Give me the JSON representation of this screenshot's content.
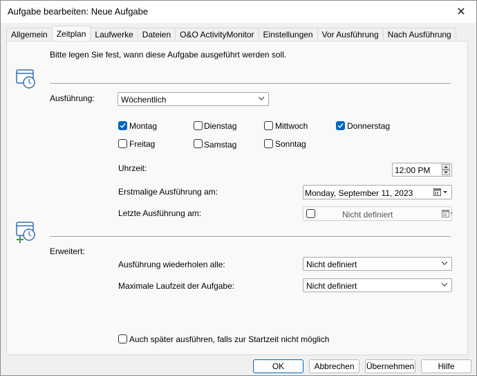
{
  "window": {
    "title": "Aufgabe bearbeiten: Neue Aufgabe",
    "close_glyph": "✕"
  },
  "tabs": [
    {
      "label": "Allgemein",
      "active": false
    },
    {
      "label": "Zeitplan",
      "active": true
    },
    {
      "label": "Laufwerke",
      "active": false
    },
    {
      "label": "Dateien",
      "active": false
    },
    {
      "label": "O&O ActivityMonitor",
      "active": false
    },
    {
      "label": "Einstellungen",
      "active": false
    },
    {
      "label": "Vor Ausführung",
      "active": false
    },
    {
      "label": "Nach Ausführung",
      "active": false
    }
  ],
  "schedule": {
    "intro": "Bitte legen Sie fest, wann diese Aufgabe ausgeführt werden soll.",
    "execution_label": "Ausführung:",
    "execution_value": "Wöchentlich",
    "days": [
      {
        "label": "Montag",
        "checked": true
      },
      {
        "label": "Dienstag",
        "checked": false
      },
      {
        "label": "Mittwoch",
        "checked": false
      },
      {
        "label": "Donnerstag",
        "checked": true
      },
      {
        "label": "Freitag",
        "checked": false
      },
      {
        "label": "Samstag",
        "checked": false
      },
      {
        "label": "Sonntag",
        "checked": false
      }
    ],
    "time_label": "Uhrzeit:",
    "time_value": "12:00 PM",
    "first_run_label": "Erstmalige Ausführung am:",
    "first_run_value": "Monday, September 11, 2023",
    "last_run_label": "Letzte Ausführung am:",
    "last_run_value": "Nicht definiert"
  },
  "advanced": {
    "label": "Erweitert:",
    "repeat_label": "Ausführung wiederholen alle:",
    "repeat_value": "Nicht definiert",
    "max_runtime_label": "Maximale Laufzeit der Aufgabe:",
    "max_runtime_value": "Nicht definiert",
    "run_later_label": "Auch später ausführen, falls zur Startzeit nicht möglich",
    "run_later_checked": false
  },
  "buttons": {
    "ok": "OK",
    "cancel": "Abbrechen",
    "apply": "Übernehmen",
    "help": "Hilfe"
  },
  "colors": {
    "accent": "#0067c0",
    "icon_blue": "#2f6fb5",
    "icon_green": "#3a9a3a"
  }
}
